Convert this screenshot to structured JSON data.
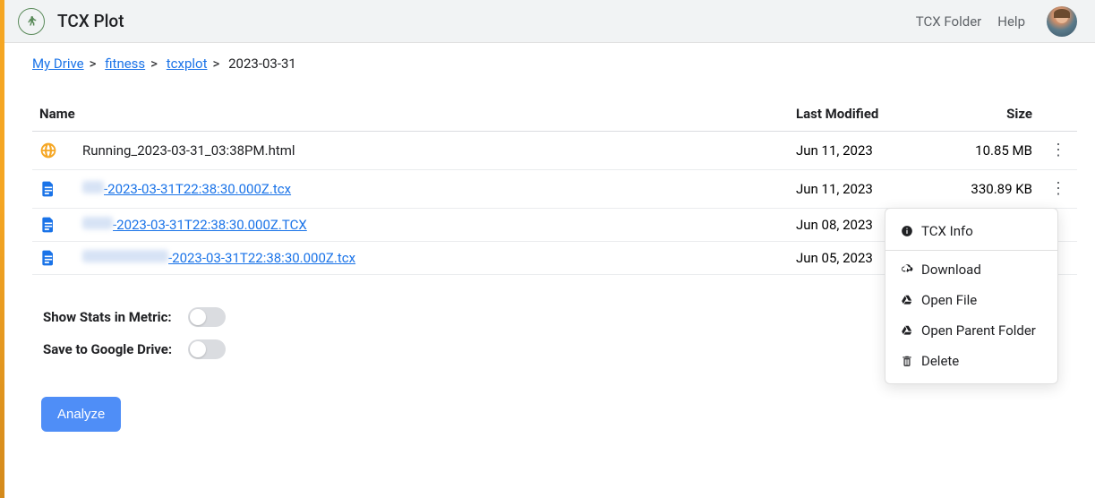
{
  "header": {
    "app_title": "TCX Plot",
    "nav": {
      "folder": "TCX Folder",
      "help": "Help"
    }
  },
  "breadcrumb": {
    "items": [
      {
        "label": "My Drive",
        "link": true
      },
      {
        "label": "fitness",
        "link": true
      },
      {
        "label": "tcxplot",
        "link": true
      },
      {
        "label": "2023-03-31",
        "link": false
      }
    ]
  },
  "table": {
    "headers": {
      "name": "Name",
      "modified": "Last Modified",
      "size": "Size"
    },
    "rows": [
      {
        "icon": "web",
        "name": "Running_2023-03-31_03:38PM.html",
        "link": false,
        "blurred_prefix": "",
        "modified": "Jun 11, 2023",
        "size": "10.85 MB",
        "has_menu": true
      },
      {
        "icon": "doc",
        "name": "-2023-03-31T22:38:30.000Z.tcx",
        "link": true,
        "blurred_prefix": "w1",
        "modified": "Jun 11, 2023",
        "size": "330.89 KB",
        "has_menu": true
      },
      {
        "icon": "doc",
        "name": "-2023-03-31T22:38:30.000Z.TCX",
        "link": true,
        "blurred_prefix": "w2",
        "modified": "Jun 08, 2023",
        "size": "",
        "has_menu": false
      },
      {
        "icon": "doc",
        "name": "-2023-03-31T22:38:30.000Z.tcx",
        "link": true,
        "blurred_prefix": "w3",
        "modified": "Jun 05, 2023",
        "size": "",
        "has_menu": false
      }
    ]
  },
  "settings": {
    "metric_label": "Show Stats in Metric:",
    "drive_label": "Save to Google Drive:"
  },
  "buttons": {
    "analyze": "Analyze"
  },
  "context_menu": {
    "items": [
      {
        "icon": "info",
        "label": "TCX Info"
      },
      {
        "divider": true
      },
      {
        "icon": "download",
        "label": "Download"
      },
      {
        "icon": "drive",
        "label": "Open File"
      },
      {
        "icon": "drive",
        "label": "Open Parent Folder"
      },
      {
        "icon": "trash",
        "label": "Delete"
      }
    ]
  }
}
